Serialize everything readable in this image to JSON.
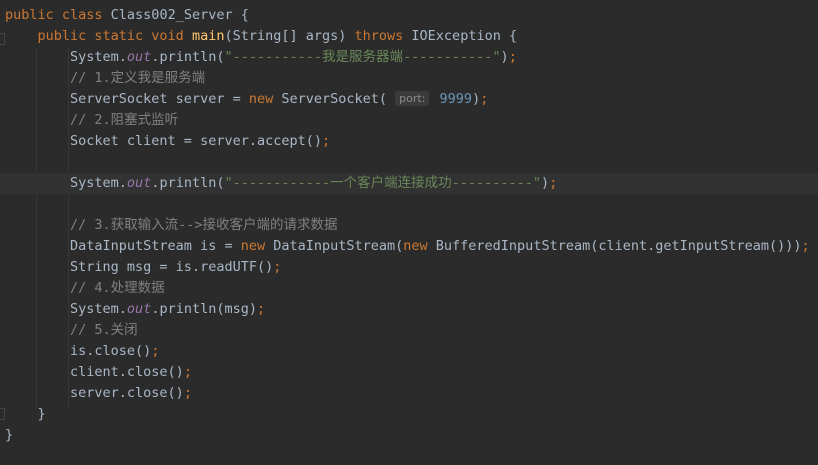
{
  "editor": {
    "theme_colors": {
      "background": "#2b2b2b",
      "current_line": "#323232",
      "keyword": "#cc7832",
      "string": "#6a8759",
      "number": "#6897bb",
      "comment": "#808080",
      "method_decl": "#ffc66d",
      "static_field": "#9876aa",
      "plain": "#a9b7c6"
    },
    "lines": [
      {
        "tokens": [
          [
            "kw",
            "public class "
          ],
          [
            "plain",
            "Class002_Server {"
          ]
        ]
      },
      {
        "tokens": [
          [
            "plain",
            "    "
          ],
          [
            "kw",
            "public static void "
          ],
          [
            "fn",
            "main"
          ],
          [
            "plain",
            "(String[] args) "
          ],
          [
            "kw",
            "throws "
          ],
          [
            "plain",
            "IOException {"
          ]
        ]
      },
      {
        "tokens": [
          [
            "plain",
            "        System."
          ],
          [
            "static-field",
            "out"
          ],
          [
            "plain",
            ".println("
          ],
          [
            "str",
            "\"-----------我是服务器端-----------\""
          ],
          [
            "plain",
            ")"
          ],
          [
            "kw",
            ";"
          ]
        ]
      },
      {
        "tokens": [
          [
            "cmt",
            "        // 1.定义我是服务端"
          ]
        ]
      },
      {
        "tokens": [
          [
            "plain",
            "        ServerSocket server = "
          ],
          [
            "kw",
            "new "
          ],
          [
            "plain",
            "ServerSocket( "
          ],
          [
            "hint",
            "port:"
          ],
          [
            "num",
            " 9999"
          ],
          [
            "plain",
            ")"
          ],
          [
            "kw",
            ";"
          ]
        ]
      },
      {
        "tokens": [
          [
            "cmt",
            "        // 2.阻塞式监听"
          ]
        ]
      },
      {
        "tokens": [
          [
            "plain",
            "        Socket client = server.accept()"
          ],
          [
            "kw",
            ";"
          ]
        ]
      },
      {
        "tokens": [
          [
            "plain",
            ""
          ]
        ]
      },
      {
        "tokens": [
          [
            "plain",
            "        System."
          ],
          [
            "static-field",
            "out"
          ],
          [
            "plain",
            ".println("
          ],
          [
            "str",
            "\"------------一个客户端连接成功----------\""
          ],
          [
            "plain",
            ")"
          ],
          [
            "kw",
            ";"
          ]
        ],
        "current": true
      },
      {
        "tokens": [
          [
            "plain",
            ""
          ]
        ]
      },
      {
        "tokens": [
          [
            "cmt",
            "        // 3.获取输入流-->接收客户端的请求数据"
          ]
        ]
      },
      {
        "tokens": [
          [
            "plain",
            "        DataInputStream is = "
          ],
          [
            "kw",
            "new "
          ],
          [
            "plain",
            "DataInputStream("
          ],
          [
            "kw",
            "new "
          ],
          [
            "plain",
            "BufferedInputStream(client.getInputStream()))"
          ],
          [
            "kw",
            ";"
          ]
        ]
      },
      {
        "tokens": [
          [
            "plain",
            "        String msg = is.readUTF()"
          ],
          [
            "kw",
            ";"
          ]
        ]
      },
      {
        "tokens": [
          [
            "cmt",
            "        // 4.处理数据"
          ]
        ]
      },
      {
        "tokens": [
          [
            "plain",
            "        System."
          ],
          [
            "static-field",
            "out"
          ],
          [
            "plain",
            ".println(msg)"
          ],
          [
            "kw",
            ";"
          ]
        ]
      },
      {
        "tokens": [
          [
            "cmt",
            "        // 5.关闭"
          ]
        ]
      },
      {
        "tokens": [
          [
            "plain",
            "        is.close()"
          ],
          [
            "kw",
            ";"
          ]
        ]
      },
      {
        "tokens": [
          [
            "plain",
            "        client.close()"
          ],
          [
            "kw",
            ";"
          ]
        ]
      },
      {
        "tokens": [
          [
            "plain",
            "        server.close()"
          ],
          [
            "kw",
            ";"
          ]
        ]
      },
      {
        "tokens": [
          [
            "plain",
            "    }"
          ]
        ]
      },
      {
        "tokens": [
          [
            "plain",
            "}"
          ]
        ]
      }
    ]
  }
}
